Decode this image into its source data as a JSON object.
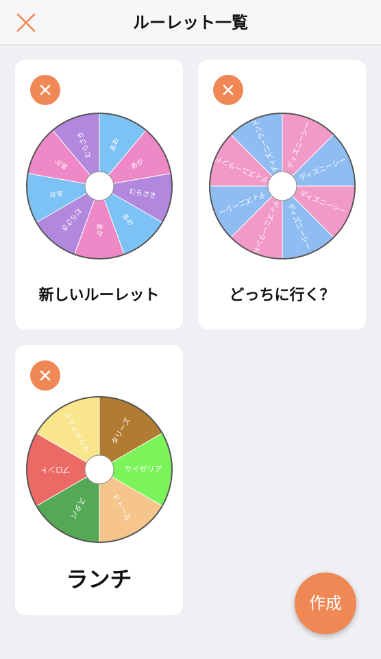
{
  "header": {
    "title": "ルーレット一覧",
    "close_icon": "close-x-icon",
    "accent_color": "#f08856"
  },
  "roulettes": [
    {
      "title": "新しいルーレット",
      "delete_icon": "close-icon",
      "segments": [
        {
          "label": "あお",
          "color": "#7cc2f4"
        },
        {
          "label": "あか",
          "color": "#ee88c6"
        },
        {
          "label": "むらさき",
          "color": "#b188dd"
        },
        {
          "label": "あお",
          "color": "#7cc2f4"
        },
        {
          "label": "あか",
          "color": "#ee88c6"
        },
        {
          "label": "むらさき",
          "color": "#b188dd"
        },
        {
          "label": "あお",
          "color": "#7cc2f4"
        },
        {
          "label": "あか",
          "color": "#ee88c6"
        },
        {
          "label": "むらさき",
          "color": "#b188dd"
        }
      ]
    },
    {
      "title": "どっちに行く？",
      "delete_icon": "close-icon",
      "segments": [
        {
          "label": "ディズニーシー",
          "color": "#f29ac7"
        },
        {
          "label": "ディズニーシー",
          "color": "#8fbdf2"
        },
        {
          "label": "ディズニーシー",
          "color": "#f29ac7"
        },
        {
          "label": "ディズニーシー",
          "color": "#8fbdf2"
        },
        {
          "label": "ディズニーランド",
          "color": "#f29ac7"
        },
        {
          "label": "ディズニーシー",
          "color": "#8fbdf2"
        },
        {
          "label": "ディズニーランド",
          "color": "#f29ac7"
        },
        {
          "label": "ディズニーランド",
          "color": "#8fbdf2"
        }
      ]
    },
    {
      "title": "ランチ",
      "delete_icon": "close-icon",
      "segments": [
        {
          "label": "タリーズ",
          "color": "#b17b31"
        },
        {
          "label": "サイゼリア",
          "color": "#7bf45a"
        },
        {
          "label": "ドトール",
          "color": "#f5c58c"
        },
        {
          "label": "スタバ",
          "color": "#55a855"
        },
        {
          "label": "プロント",
          "color": "#ec6a66"
        },
        {
          "label": "マクドナルド",
          "color": "#f8e58c"
        }
      ]
    }
  ],
  "fab": {
    "label": "作成"
  }
}
